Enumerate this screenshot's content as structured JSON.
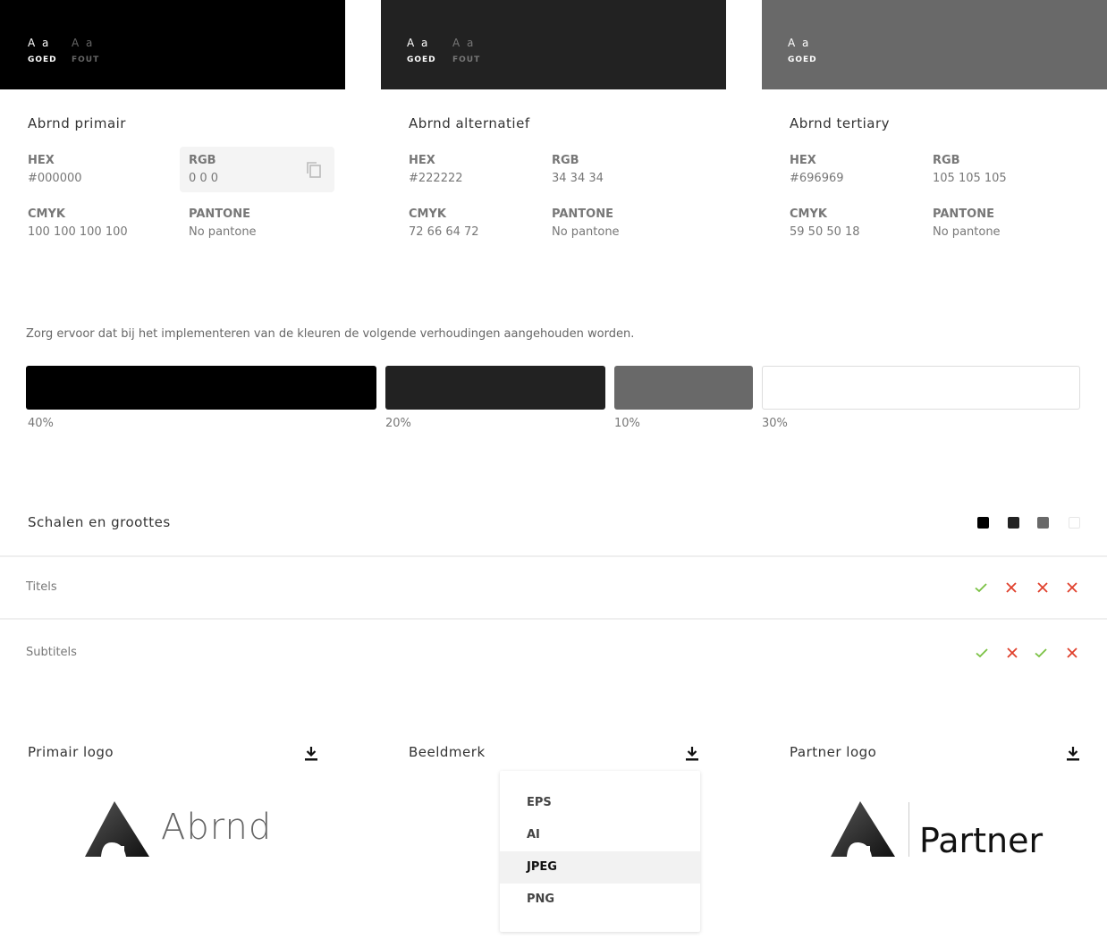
{
  "colors": [
    {
      "name": "Abrnd primair",
      "hex_color": "#000000",
      "aa_good": "A a",
      "good_label": "GOED",
      "aa_bad": "A a",
      "bad_label": "FOUT",
      "hex_label": "HEX",
      "hex": "#000000",
      "rgb_label": "RGB",
      "rgb": "0 0 0",
      "cmyk_label": "CMYK",
      "cmyk": "100 100 100 100",
      "pantone_label": "PANTONE",
      "pantone": "No pantone"
    },
    {
      "name": "Abrnd alternatief",
      "hex_color": "#222222",
      "aa_good": "A a",
      "good_label": "GOED",
      "aa_bad": "A a",
      "bad_label": "FOUT",
      "hex_label": "HEX",
      "hex": "#222222",
      "rgb_label": "RGB",
      "rgb": "34 34 34",
      "cmyk_label": "CMYK",
      "cmyk": "72 66 64 72",
      "pantone_label": "PANTONE",
      "pantone": "No pantone"
    },
    {
      "name": "Abrnd tertiary",
      "hex_color": "#696969",
      "aa_good": "A a",
      "good_label": "GOED",
      "hex_label": "HEX",
      "hex": "#696969",
      "rgb_label": "RGB",
      "rgb": "105 105 105",
      "cmyk_label": "CMYK",
      "cmyk": "59 50 50 18",
      "pantone_label": "PANTONE",
      "pantone": "No pantone"
    }
  ],
  "ratio": {
    "intro": "Zorg ervoor dat bij het implementeren van de kleuren de volgende verhoudingen aangehouden worden.",
    "segments": [
      {
        "color": "#000000",
        "percent": 40,
        "label": "40%"
      },
      {
        "color": "#222222",
        "percent": 20,
        "label": "20%"
      },
      {
        "color": "#696969",
        "percent": 10,
        "label": "10%"
      },
      {
        "color": "#ffffff",
        "percent": 30,
        "label": "30%"
      }
    ]
  },
  "scales": {
    "title": "Schalen en groottes",
    "swatches": [
      "#000000",
      "#222222",
      "#696969",
      "#ffffff"
    ],
    "rows": [
      {
        "label": "Titels",
        "marks": [
          "check",
          "cross",
          "cross",
          "cross"
        ]
      },
      {
        "label": "Subtitels",
        "marks": [
          "check",
          "cross",
          "check",
          "cross"
        ]
      }
    ],
    "check_color": "#7ac143",
    "cross_color": "#e0402c"
  },
  "logos": [
    {
      "title": "Primair logo",
      "wordmark": "Abrnd",
      "icon": "download-icon"
    },
    {
      "title": "Beeldmerk",
      "icon": "download-icon"
    },
    {
      "title": "Partner logo",
      "wordmark": "Partner",
      "icon": "download-icon"
    }
  ],
  "download_menu": {
    "options": [
      "EPS",
      "AI",
      "JPEG",
      "PNG"
    ],
    "selected": "JPEG"
  }
}
